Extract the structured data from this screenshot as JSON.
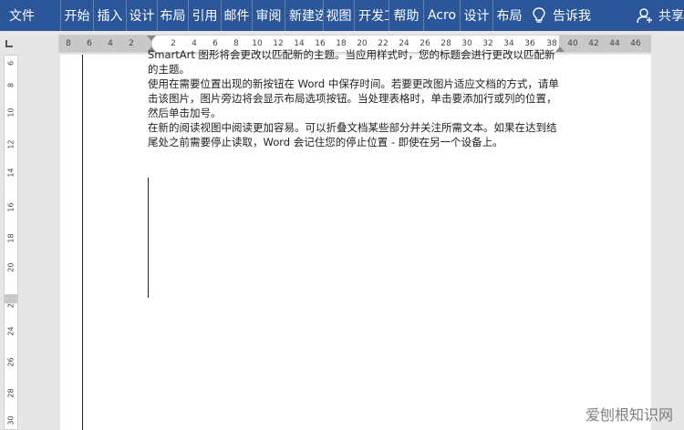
{
  "ribbon": {
    "tabs": [
      "文件",
      "开始",
      "插入",
      "设计",
      "布局",
      "引用",
      "邮件",
      "审阅",
      "新建选",
      "视图",
      "开发工",
      "帮助",
      "Acro",
      "设计",
      "布局"
    ],
    "tell_me": "告诉我",
    "share": "共享"
  },
  "ruler": {
    "h_ticks": [
      "8",
      "6",
      "4",
      "2",
      "2",
      "4",
      "6",
      "8",
      "10",
      "12",
      "14",
      "16",
      "18",
      "20",
      "22",
      "24",
      "26",
      "28",
      "30",
      "32",
      "34",
      "36",
      "38",
      "40",
      "42",
      "44",
      "46"
    ],
    "v_ticks": [
      "6",
      "8",
      "10",
      "12",
      "14",
      "16",
      "18",
      "20",
      "2",
      "24",
      "26",
      "28",
      "30"
    ]
  },
  "document": {
    "paragraphs": [
      "SmartArt 图形将会更改以匹配新的主题。当应用样式时，您的标题会进行更改以匹配新的主题。",
      "使用在需要位置出现的新按钮在 Word 中保存时间。若要更改图片适应文档的方式，请单击该图片，图片旁边将会显示布局选项按钮。当处理表格时，单击要添加行或列的位置，然后单击加号。",
      "在新的阅读视图中阅读更加容易。可以折叠文档某些部分并关注所需文本。如果在达到结尾处之前需要停止读取，Word 会记住您的停止位置 - 即使在另一个设备上。"
    ]
  },
  "watermark": "爱刨根知识网",
  "colors": {
    "ribbon": "#2b579a"
  }
}
